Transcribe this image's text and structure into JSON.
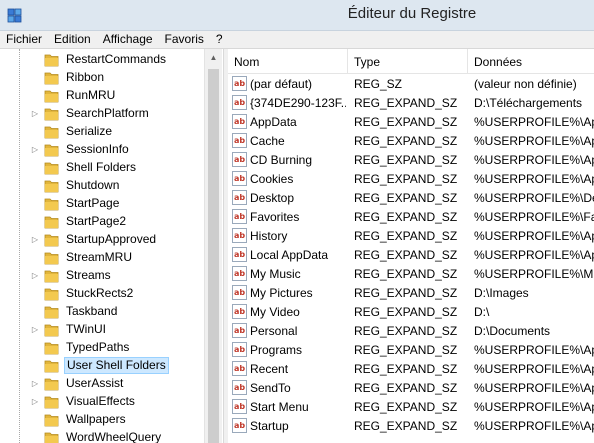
{
  "window": {
    "title": "Éditeur du Registre",
    "icon": "regedit-icon"
  },
  "menu": [
    "Fichier",
    "Edition",
    "Affichage",
    "Favoris",
    "?"
  ],
  "tree": {
    "items": [
      {
        "label": "RestartCommands",
        "expandable": false,
        "selected": false
      },
      {
        "label": "Ribbon",
        "expandable": false,
        "selected": false
      },
      {
        "label": "RunMRU",
        "expandable": false,
        "selected": false
      },
      {
        "label": "SearchPlatform",
        "expandable": true,
        "selected": false
      },
      {
        "label": "Serialize",
        "expandable": false,
        "selected": false
      },
      {
        "label": "SessionInfo",
        "expandable": true,
        "selected": false
      },
      {
        "label": "Shell Folders",
        "expandable": false,
        "selected": false
      },
      {
        "label": "Shutdown",
        "expandable": false,
        "selected": false
      },
      {
        "label": "StartPage",
        "expandable": false,
        "selected": false
      },
      {
        "label": "StartPage2",
        "expandable": false,
        "selected": false
      },
      {
        "label": "StartupApproved",
        "expandable": true,
        "selected": false
      },
      {
        "label": "StreamMRU",
        "expandable": false,
        "selected": false
      },
      {
        "label": "Streams",
        "expandable": true,
        "selected": false
      },
      {
        "label": "StuckRects2",
        "expandable": false,
        "selected": false
      },
      {
        "label": "Taskband",
        "expandable": false,
        "selected": false
      },
      {
        "label": "TWinUI",
        "expandable": true,
        "selected": false
      },
      {
        "label": "TypedPaths",
        "expandable": false,
        "selected": false
      },
      {
        "label": "User Shell Folders",
        "expandable": false,
        "selected": true
      },
      {
        "label": "UserAssist",
        "expandable": true,
        "selected": false
      },
      {
        "label": "VisualEffects",
        "expandable": true,
        "selected": false
      },
      {
        "label": "Wallpapers",
        "expandable": false,
        "selected": false
      },
      {
        "label": "WordWheelQuery",
        "expandable": false,
        "selected": false
      }
    ]
  },
  "list": {
    "columns": [
      "Nom",
      "Type",
      "Données"
    ],
    "rows": [
      {
        "name": "(par défaut)",
        "type": "REG_SZ",
        "data": "(valeur non définie)"
      },
      {
        "name": "{374DE290-123F...",
        "type": "REG_EXPAND_SZ",
        "data": "D:\\Téléchargements"
      },
      {
        "name": "AppData",
        "type": "REG_EXPAND_SZ",
        "data": "%USERPROFILE%\\Appl"
      },
      {
        "name": "Cache",
        "type": "REG_EXPAND_SZ",
        "data": "%USERPROFILE%\\Appl"
      },
      {
        "name": "CD Burning",
        "type": "REG_EXPAND_SZ",
        "data": "%USERPROFILE%\\Appl"
      },
      {
        "name": "Cookies",
        "type": "REG_EXPAND_SZ",
        "data": "%USERPROFILE%\\Appl"
      },
      {
        "name": "Desktop",
        "type": "REG_EXPAND_SZ",
        "data": "%USERPROFILE%\\Desk"
      },
      {
        "name": "Favorites",
        "type": "REG_EXPAND_SZ",
        "data": "%USERPROFILE%\\Favo"
      },
      {
        "name": "History",
        "type": "REG_EXPAND_SZ",
        "data": "%USERPROFILE%\\Appl"
      },
      {
        "name": "Local AppData",
        "type": "REG_EXPAND_SZ",
        "data": "%USERPROFILE%\\Appl"
      },
      {
        "name": "My Music",
        "type": "REG_EXPAND_SZ",
        "data": "%USERPROFILE%\\Mus"
      },
      {
        "name": "My Pictures",
        "type": "REG_EXPAND_SZ",
        "data": "D:\\Images"
      },
      {
        "name": "My Video",
        "type": "REG_EXPAND_SZ",
        "data": "D:\\"
      },
      {
        "name": "Personal",
        "type": "REG_EXPAND_SZ",
        "data": "D:\\Documents"
      },
      {
        "name": "Programs",
        "type": "REG_EXPAND_SZ",
        "data": "%USERPROFILE%\\Appl"
      },
      {
        "name": "Recent",
        "type": "REG_EXPAND_SZ",
        "data": "%USERPROFILE%\\Appl"
      },
      {
        "name": "SendTo",
        "type": "REG_EXPAND_SZ",
        "data": "%USERPROFILE%\\Appl"
      },
      {
        "name": "Start Menu",
        "type": "REG_EXPAND_SZ",
        "data": "%USERPROFILE%\\Appl"
      },
      {
        "name": "Startup",
        "type": "REG_EXPAND_SZ",
        "data": "%USERPROFILE%\\Appl"
      }
    ]
  },
  "colors": {
    "titlebar": "#dde7f0",
    "selection": "#cde8ff",
    "folder": "#f3c94f"
  }
}
